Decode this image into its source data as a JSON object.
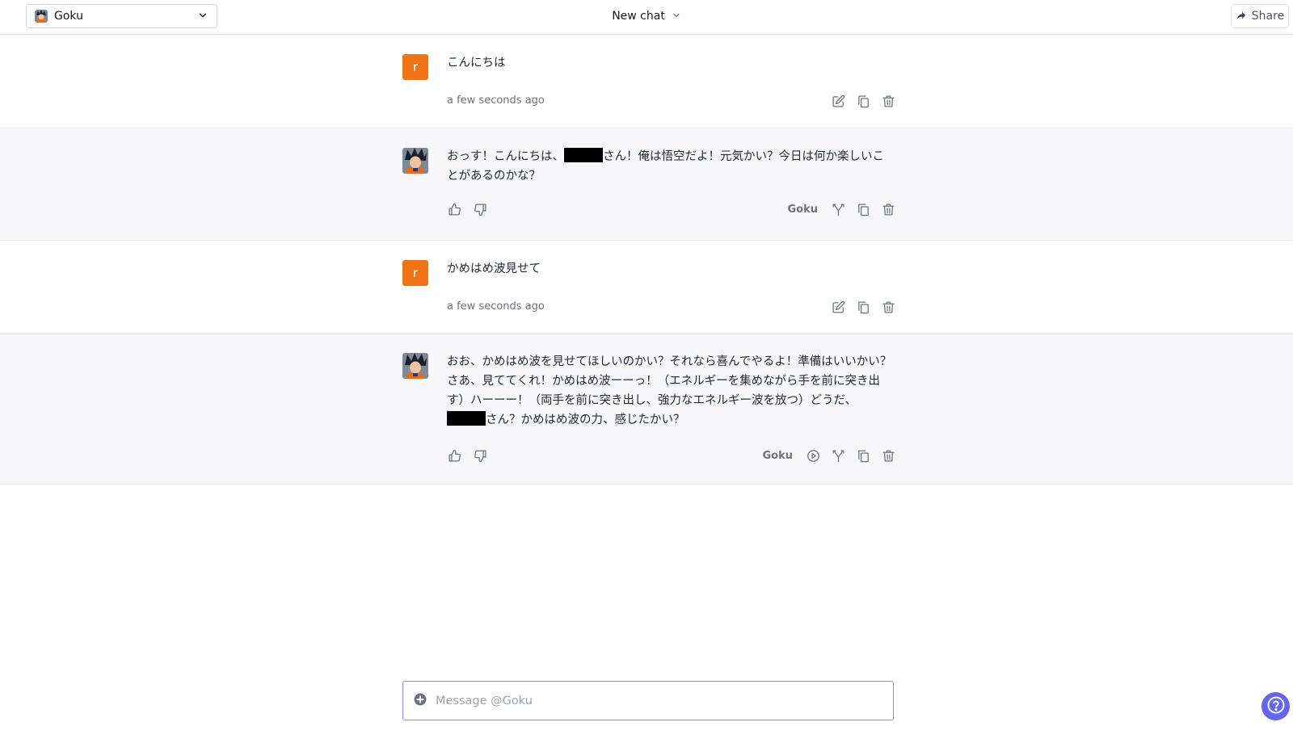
{
  "header": {
    "model_label": "Goku",
    "chat_title": "New chat",
    "share_label": "Share"
  },
  "messages": [
    {
      "role": "user",
      "avatar_letter": "r",
      "text": "こんにちは",
      "time": "a few seconds ago"
    },
    {
      "role": "assistant",
      "text_before": "おっす！こんにちは、",
      "text_after": "さん！俺は悟空だよ！元気かい？今日は何か楽しいことがあるのかな？",
      "model_name": "Goku"
    },
    {
      "role": "user",
      "avatar_letter": "r",
      "text": "かめはめ波見せて",
      "time": "a few seconds ago"
    },
    {
      "role": "assistant",
      "text_before": "おお、かめはめ波を見せてほしいのかい？それなら喜んでやるよ！準備はいいかい？さあ、見ててくれ！かめはめ波ーーっ！（エネルギーを集めながら手を前に突き出す）ハーーー！（両手を前に突き出し、強力なエネルギー波を放つ）どうだ、",
      "text_after": "さん？かめはめ波の力、感じたかい？",
      "model_name": "Goku"
    }
  ],
  "composer": {
    "placeholder": "Message @Goku"
  },
  "colors": {
    "user_avatar": "#f07316",
    "accent": "#6366f1",
    "composer_border": "#8b8cf0",
    "bot_row_bg": "#f7f7f9"
  },
  "icons": {
    "edit": "edit-icon",
    "copy": "copy-icon",
    "delete": "trash-icon",
    "thumbs_up": "thumbs-up-icon",
    "thumbs_down": "thumbs-down-icon",
    "fork": "fork-icon",
    "play": "play-icon",
    "share": "share-icon",
    "plus": "plus-circle-icon",
    "help": "help-icon"
  }
}
